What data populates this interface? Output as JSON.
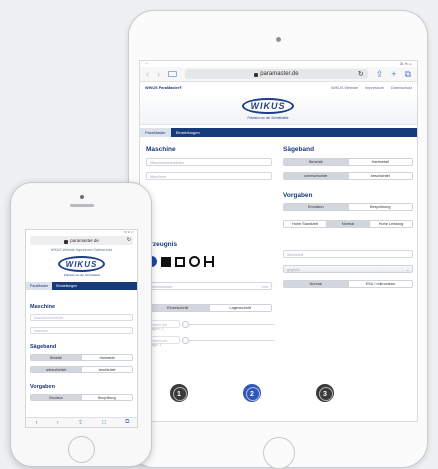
{
  "ipad": {
    "status_right": "31 % ▭",
    "browser": {
      "url": "paramaster.de",
      "back_icon": "chevron-left-icon",
      "forward_icon": "chevron-right-icon",
      "reload_icon": "reload-icon",
      "share_icon": "share-icon",
      "add_icon": "plus-icon",
      "tabs_icon": "tabs-icon",
      "back_glyph": "‹",
      "forward_glyph": "›",
      "reload_glyph": "↻",
      "share_glyph": "⇪",
      "add_glyph": "+",
      "tabs_glyph": "⧉"
    },
    "site": {
      "brand": "WIKUS ParaMaster®",
      "links": [
        "WIKUS Website",
        "Impressum",
        "Datenschutz"
      ],
      "logo_text": "WIKUS",
      "logo_sub": "Präzision an der Schnittstelle",
      "tabs": [
        "ParaMaster",
        "Einstellungen"
      ]
    },
    "maschine": {
      "heading": "Maschine",
      "hersteller_placeholder": "Maschinenhersteller",
      "maschine_placeholder": "Maschine"
    },
    "saegeband": {
      "heading": "Sägeband",
      "material": [
        "Bimetall",
        "Hartmetall"
      ],
      "coating": [
        "unbeschichtet",
        "beschichtet"
      ]
    },
    "vorgaben": {
      "heading": "Vorgaben",
      "kuehlung": [
        "Emulsion",
        "Besprühung"
      ],
      "standzeit": [
        "Hohe Standzeit",
        "Normal",
        "Hohe Leistung"
      ]
    },
    "werkstoff": {
      "placeholder": "Werkstoff",
      "select_value": "geglüht",
      "profile": [
        "Normal",
        "ESU / mikroclean"
      ]
    },
    "erzeugnis": {
      "heading": "Erzeugnis",
      "shape_icons": [
        "round-bar-icon",
        "square-bar-icon",
        "square-tube-icon",
        "round-tube-icon",
        "beam-profile-icon"
      ],
      "durchmesser_placeholder": "Durchmesser",
      "durchmesser_unit": "mm",
      "schnitt": [
        "Einzelschnitt",
        "Lagenschnitt"
      ],
      "slider1_label": "Anzahl der Lagen: 1",
      "slider2_label": "Anzahl pro Lage: 1"
    },
    "steps": [
      "1",
      "2",
      "3"
    ],
    "active_step": "2"
  },
  "iphone": {
    "status_right": "71 % ▭",
    "url": "paramaster.de",
    "reload_glyph": "↻",
    "links": "WIKUS Website   Impressum   Datenschutz",
    "logo_text": "WIKUS",
    "logo_sub": "Präzision an der Schnittstelle",
    "tabs": [
      "ParaMaster",
      "Einstellungen"
    ],
    "maschine": {
      "heading": "Maschine",
      "hersteller_placeholder": "Maschinenhersteller",
      "maschine_placeholder": "Maschine"
    },
    "saegeband": {
      "heading": "Sägeband",
      "material": [
        "Bimetall",
        "Hartmetall"
      ],
      "coating": [
        "unbeschichtet",
        "beschichtet"
      ]
    },
    "vorgaben": {
      "heading": "Vorgaben",
      "kuehlung": [
        "Emulsion",
        "Besprühung"
      ]
    },
    "toolbar_glyphs": [
      "‹",
      "›",
      "⇪",
      "□",
      "⧉"
    ]
  },
  "colors": {
    "brand_blue": "#173a7a",
    "active_step": "#2f57b8",
    "inactive_step": "#3b3b3d",
    "segment_on": "#d3d6dc"
  }
}
